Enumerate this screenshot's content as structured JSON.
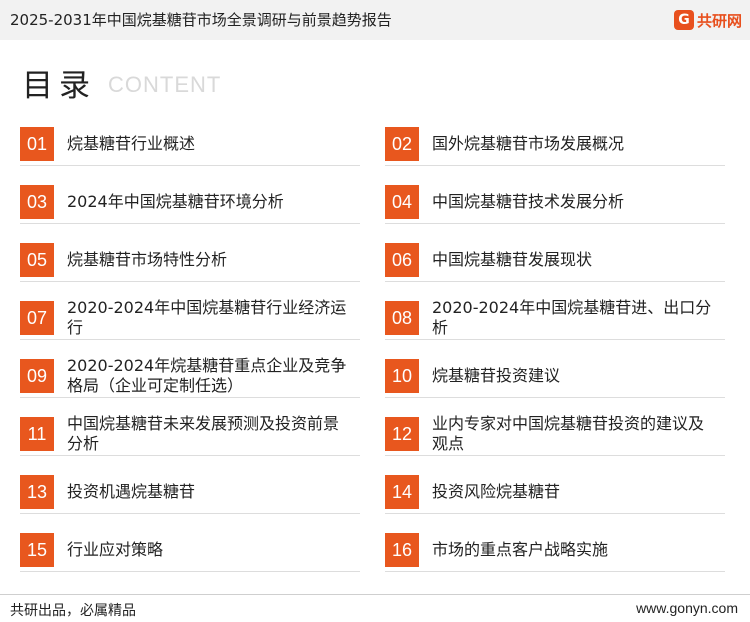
{
  "header": {
    "title": "2025-2031年中国烷基糖苷市场全景调研与前景趋势报告",
    "logo_text": "共研网",
    "logo_icon": "g-logo-icon"
  },
  "page_title": {
    "main": "目录",
    "sub": "CONTENT"
  },
  "toc": [
    {
      "num": "01",
      "label": "烷基糖苷行业概述"
    },
    {
      "num": "02",
      "label": "国外烷基糖苷市场发展概况"
    },
    {
      "num": "03",
      "label": "2024年中国烷基糖苷环境分析"
    },
    {
      "num": "04",
      "label": "中国烷基糖苷技术发展分析"
    },
    {
      "num": "05",
      "label": "烷基糖苷市场特性分析"
    },
    {
      "num": "06",
      "label": "中国烷基糖苷发展现状"
    },
    {
      "num": "07",
      "label": "2020-2024年中国烷基糖苷行业经济运行"
    },
    {
      "num": "08",
      "label": "2020-2024年中国烷基糖苷进、出口分析"
    },
    {
      "num": "09",
      "label": "2020-2024年烷基糖苷重点企业及竞争格局（企业可定制任选）"
    },
    {
      "num": "10",
      "label": "烷基糖苷投资建议"
    },
    {
      "num": "11",
      "label": "中国烷基糖苷未来发展预测及投资前景分析"
    },
    {
      "num": "12",
      "label": "业内专家对中国烷基糖苷投资的建议及观点"
    },
    {
      "num": "13",
      "label": "投资机遇烷基糖苷"
    },
    {
      "num": "14",
      "label": "投资风险烷基糖苷"
    },
    {
      "num": "15",
      "label": "行业应对策略"
    },
    {
      "num": "16",
      "label": "市场的重点客户战略实施"
    }
  ],
  "footer": {
    "left": "共研出品，必属精品",
    "right": "www.gonyn.com"
  },
  "colors": {
    "accent": "#e8571e",
    "header_bg": "#f2f2f2"
  }
}
